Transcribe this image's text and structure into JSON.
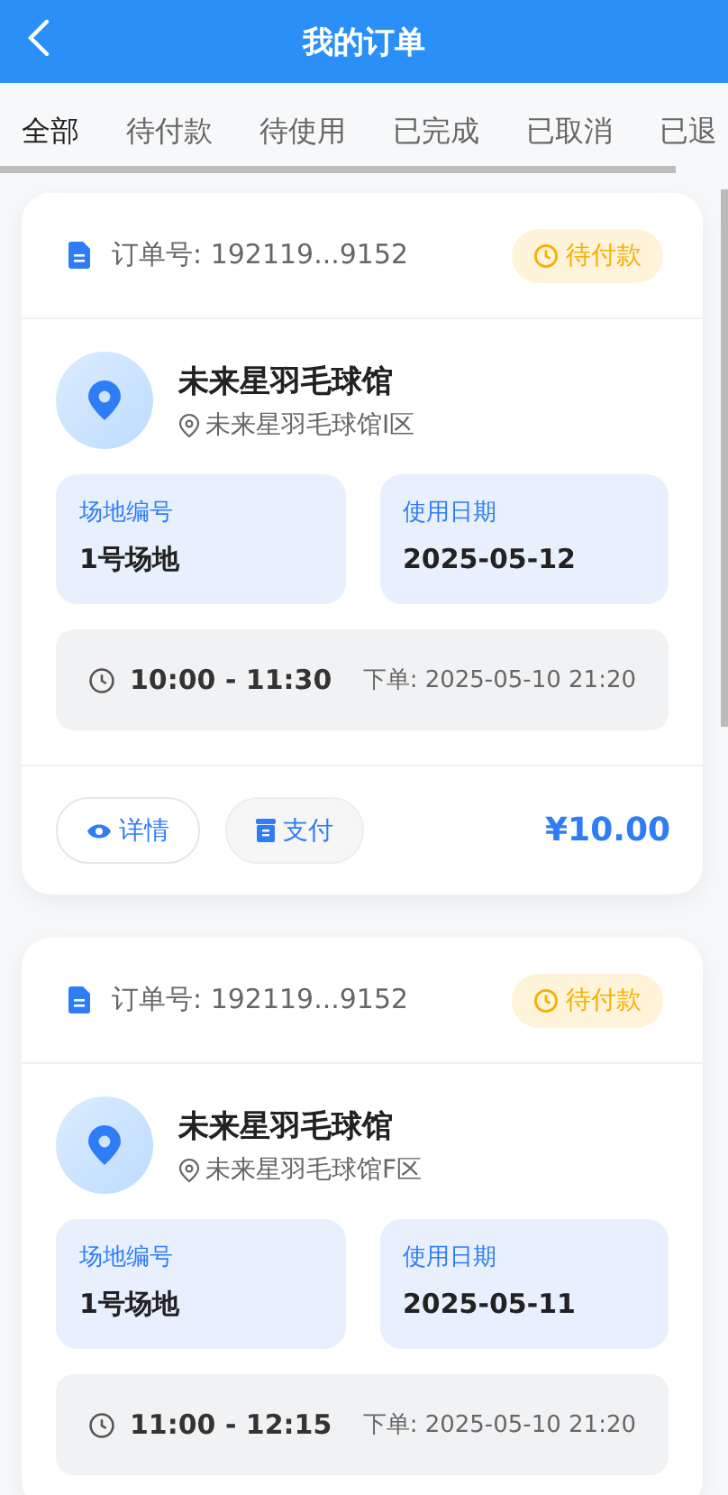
{
  "header": {
    "title": "我的订单"
  },
  "tabs": [
    {
      "label": "全部",
      "selected": true
    },
    {
      "label": "待付款",
      "selected": false
    },
    {
      "label": "待使用",
      "selected": false
    },
    {
      "label": "已完成",
      "selected": false
    },
    {
      "label": "已取消",
      "selected": false
    },
    {
      "label": "已退",
      "selected": false
    }
  ],
  "orders": [
    {
      "order_no": "订单号: 192119...9152",
      "status": {
        "label": "待付款",
        "kind": "pending"
      },
      "venue": "未来星羽毛球馆",
      "address": "未来星羽毛球馆I区",
      "field_label": "场地编号",
      "field": "1号场地",
      "date_label": "使用日期",
      "date": "2025-05-12",
      "time": "10:00 - 11:30",
      "ordered_at": "下单: 2025-05-10 21:20",
      "actions": [
        {
          "label": "详情",
          "kind": "detail"
        },
        {
          "label": "支付",
          "kind": "pay"
        }
      ],
      "price": "¥10.00"
    },
    {
      "order_no": "订单号: 192119...9152",
      "status": {
        "label": "待付款",
        "kind": "pending"
      },
      "venue": "未来星羽毛球馆",
      "address": "未来星羽毛球馆F区",
      "field_label": "场地编号",
      "field": "1号场地",
      "date_label": "使用日期",
      "date": "2025-05-11",
      "time": "11:00 - 12:15",
      "ordered_at": "下单: 2025-05-10 21:20"
    }
  ]
}
